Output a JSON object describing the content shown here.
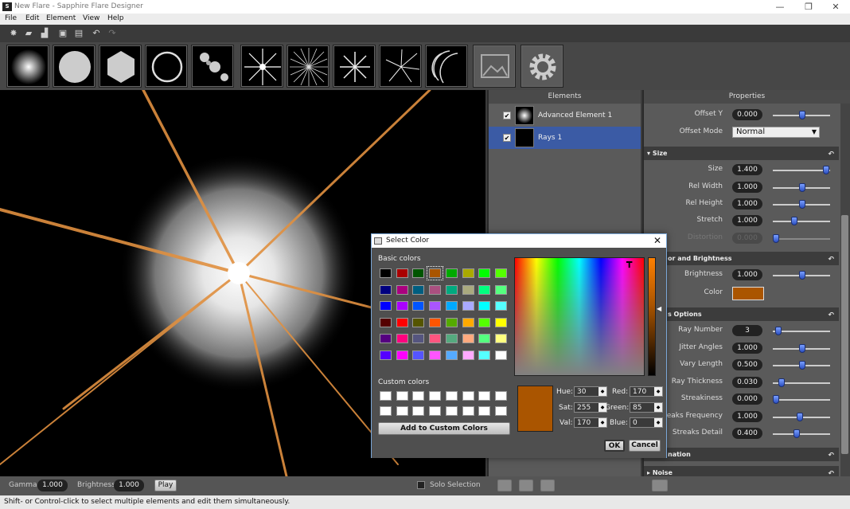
{
  "window": {
    "title": "New Flare - Sapphire Flare Designer",
    "app_icon": "S",
    "minimize": "—",
    "restore": "❐",
    "close": "✕"
  },
  "menu": [
    "File",
    "Edit",
    "Element",
    "View",
    "Help"
  ],
  "toolbar_icons": [
    "new-icon",
    "open-icon",
    "open-folder-icon",
    "save-icon",
    "save-as-icon",
    "undo-icon",
    "redo-icon"
  ],
  "element_types": [
    "glow",
    "circle",
    "hexagon",
    "ring",
    "circles-multi",
    "star-rays",
    "rays",
    "streaks",
    "sparkle-rays",
    "arc-streaks",
    "image-element",
    "settings-gear"
  ],
  "viewport": {
    "gamma_label": "Gamma",
    "gamma_value": "1.000",
    "brightness_label": "Brightness",
    "brightness_value": "1.000",
    "play_label": "Play",
    "solo_label": "Solo Selection"
  },
  "elements_panel": {
    "header": "Elements",
    "items": [
      {
        "label": "Advanced Element 1",
        "checked": "✔"
      },
      {
        "label": "Rays 1",
        "checked": "✔"
      }
    ]
  },
  "properties_panel": {
    "header": "Properties",
    "rows_top": [
      {
        "label": "Offset Y",
        "value": "0.000",
        "level": 0.5
      }
    ],
    "offset_mode_label": "Offset Mode",
    "offset_mode_value": "Normal",
    "size_section": "Size",
    "size_rows": [
      {
        "label": "Size",
        "value": "1.400",
        "level": 0.95
      },
      {
        "label": "Rel Width",
        "value": "1.000",
        "level": 0.5
      },
      {
        "label": "Rel Height",
        "value": "1.000",
        "level": 0.5
      },
      {
        "label": "Stretch",
        "value": "1.000",
        "level": 0.35
      },
      {
        "label": "Distortion",
        "value": "0.000",
        "level": 0.0
      }
    ],
    "color_section": "Color and Brightness",
    "color_section_visible": "or and Brightness",
    "brightness_label": "Brightness",
    "brightness_value": "1.000",
    "color_label": "Color",
    "color_hex": "#aa5500",
    "options_section_visible": "s Options",
    "options_rows": [
      {
        "label": "Ray Number",
        "value": "3",
        "level": 0.05
      },
      {
        "label": "Jitter Angles",
        "value": "1.000",
        "level": 0.5
      },
      {
        "label": "Vary Length",
        "value": "0.500",
        "level": 0.5
      },
      {
        "label": "Ray Thickness",
        "value": "0.030",
        "level": 0.1
      },
      {
        "label": "Streakiness",
        "value": "0.000",
        "level": 0.0
      },
      {
        "label": "treaks Frequency",
        "value": "1.000",
        "level": 0.45
      },
      {
        "label": "Streaks Detail",
        "value": "0.400",
        "level": 0.4
      }
    ],
    "animation_section_visible": "nation",
    "noise_section": "Noise"
  },
  "dialog": {
    "title": "Select Color",
    "basic_colors_label": "Basic colors",
    "basic_colors": [
      "#000000",
      "#aa0000",
      "#005500",
      "#aa5500",
      "#00aa00",
      "#aaaa00",
      "#00ff00",
      "#55ff00",
      "#000080",
      "#aa007f",
      "#005e80",
      "#aa5080",
      "#00aa7f",
      "#aaaa7f",
      "#00ff7f",
      "#55ff7f",
      "#0000ff",
      "#aa00ff",
      "#0055ff",
      "#aa55ff",
      "#00aaff",
      "#aaaaff",
      "#00ffff",
      "#55ffff",
      "#550000",
      "#ff0000",
      "#555500",
      "#ff5500",
      "#55aa00",
      "#ffaa00",
      "#55ff00",
      "#ffff00",
      "#550080",
      "#ff007f",
      "#55557f",
      "#ff557f",
      "#55aa7f",
      "#ffaa7f",
      "#55ff7f",
      "#ffff7f",
      "#5500ff",
      "#ff00ff",
      "#5555ff",
      "#ff55ff",
      "#55aaff",
      "#ffaaff",
      "#55ffff",
      "#ffffff"
    ],
    "custom_colors_label": "Custom colors",
    "add_custom_label": "Add to Custom Colors",
    "hue_label": "Hue:",
    "hue": "30",
    "sat_label": "Sat:",
    "sat": "255",
    "val_label": "Val:",
    "val": "170",
    "red_label": "Red:",
    "red": "170",
    "green_label": "Green:",
    "green": "85",
    "blue_label": "Blue:",
    "blue": "0",
    "ok_label": "OK",
    "cancel_label": "Cancel",
    "current_color": "#aa5500"
  },
  "status": "Shift- or Control-click to select multiple elements and edit them simultaneously."
}
